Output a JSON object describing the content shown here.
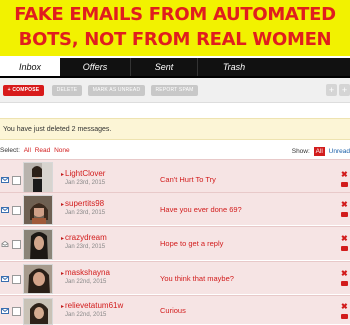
{
  "banner": {
    "line1": "FAKE EMAILS FROM AUTOMATED",
    "line2": "BOTS, NOT FROM REAL WOMEN",
    "background": "#f2f200",
    "text_color": "#e01e1e"
  },
  "tabs": [
    {
      "label": "Inbox",
      "active": true
    },
    {
      "label": "Offers",
      "active": false
    },
    {
      "label": "Sent",
      "active": false
    },
    {
      "label": "Trash",
      "active": false
    }
  ],
  "toolbar": {
    "compose": "+ COMPOSE",
    "delete": "DELETE",
    "mark_unread": "MARK AS UNREAD",
    "report_spam": "REPORT SPAM",
    "prev": "+",
    "next": "+"
  },
  "notice": "You have just deleted 2 messages.",
  "selection": {
    "label": "Select:",
    "all": "All",
    "read": "Read",
    "none": "None"
  },
  "show": {
    "label": "Show:",
    "all": "All",
    "unread": "Unread"
  },
  "messages": [
    {
      "name": "LightClover",
      "date": "Jan 23rd, 2015",
      "subject": "Can't Hurt To Try",
      "icon": "envelope-icon"
    },
    {
      "name": "supertits98",
      "date": "Jan 23rd, 2015",
      "subject": "Have you ever done 69?",
      "icon": "envelope-icon"
    },
    {
      "name": "crazydream",
      "date": "Jan 23rd, 2015",
      "subject": "Hope to get a reply",
      "icon": "open-envelope-icon"
    },
    {
      "name": "maskshayna",
      "date": "Jan 22nd, 2015",
      "subject": "You think that maybe?",
      "icon": "envelope-icon"
    },
    {
      "name": "relievetatum61w",
      "date": "Jan 22nd, 2015",
      "subject": "Curious",
      "icon": "envelope-icon"
    }
  ],
  "colors": {
    "accent": "#d21c1c",
    "row_background": "#f6e4e4",
    "notice_background": "#fcf5d6"
  }
}
